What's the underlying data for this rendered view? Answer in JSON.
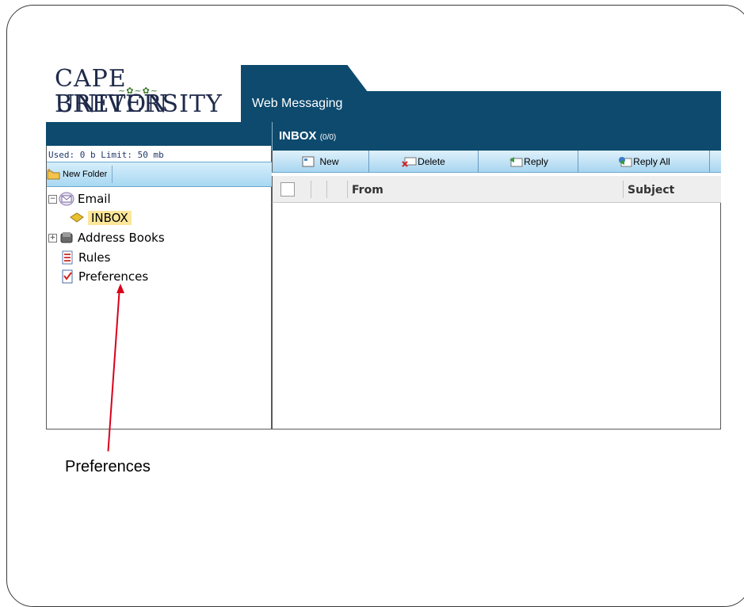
{
  "logo": {
    "line1": "CAPE BRETON",
    "line2": "UNIVERSITY"
  },
  "header": {
    "app_title": "Web Messaging"
  },
  "sidebar": {
    "usage": "Used: 0 b Limit: 50 mb",
    "new_folder_label": "New Folder",
    "tree": [
      {
        "label": "Email",
        "icon": "envelope-icon",
        "expander": "⊟"
      },
      {
        "label": "INBOX",
        "icon": "inbox-folder-icon",
        "selected": true
      },
      {
        "label": "Address Books",
        "icon": "address-book-icon",
        "expander": "⊞"
      },
      {
        "label": "Rules",
        "icon": "rules-icon"
      },
      {
        "label": "Preferences",
        "icon": "preferences-icon"
      }
    ]
  },
  "main": {
    "folder_title": "INBOX",
    "folder_count": "(0/0)",
    "toolbar": [
      {
        "label": "New",
        "icon": "new-message-icon"
      },
      {
        "label": "Delete",
        "icon": "delete-icon"
      },
      {
        "label": "Reply",
        "icon": "reply-icon"
      },
      {
        "label": "Reply All",
        "icon": "reply-all-icon"
      }
    ],
    "columns": {
      "from": "From",
      "subject": "Subject"
    }
  },
  "callout": {
    "label": "Preferences",
    "color": "#d9001b"
  },
  "colors": {
    "brand_band": "#0d4a6e",
    "toolbar_light": "#dff1fb",
    "selection": "#fbe69a"
  }
}
